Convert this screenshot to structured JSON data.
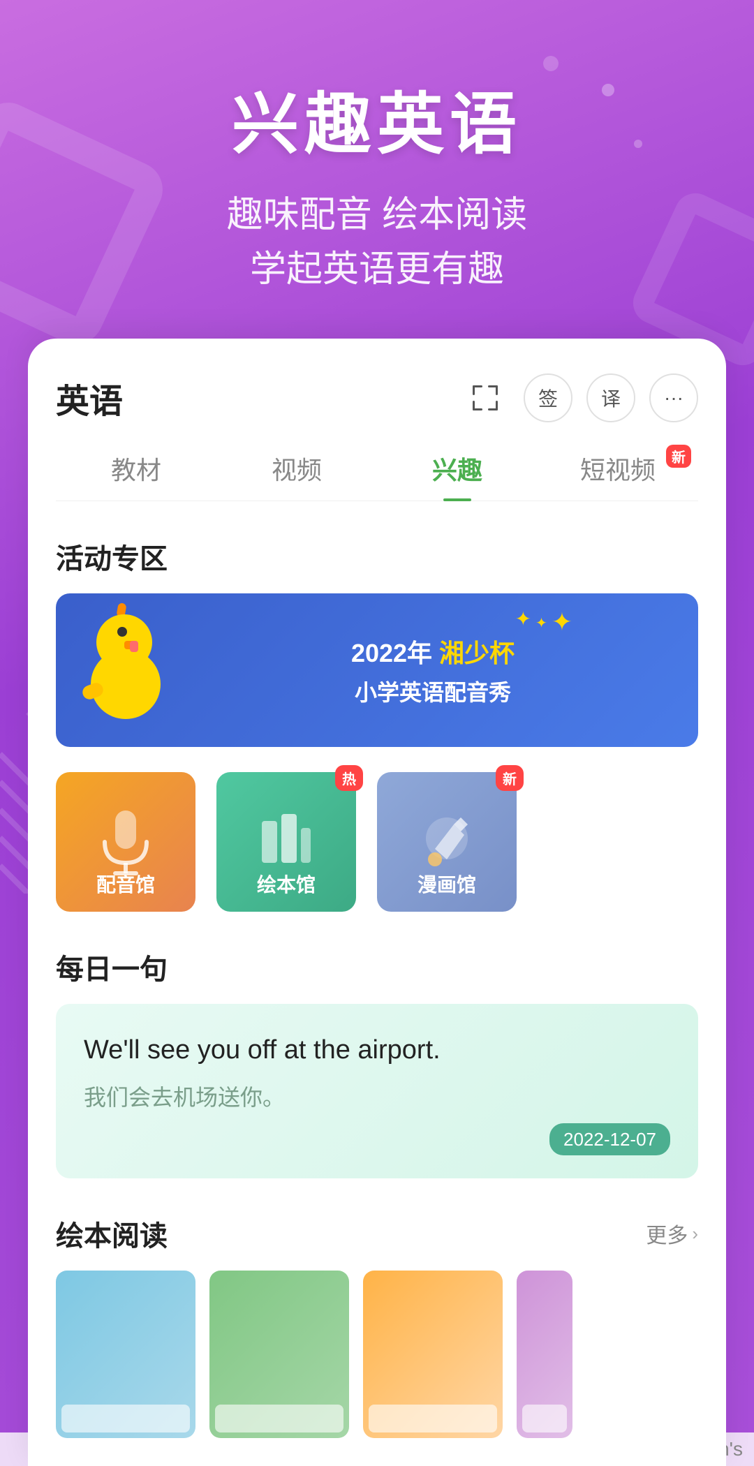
{
  "app": {
    "bg_color": "#9b3fd4"
  },
  "header": {
    "main_title": "兴趣英语",
    "sub_title_line1": "趣味配音 绘本阅读",
    "sub_title_line2": "学起英语更有趣"
  },
  "card": {
    "title": "英语",
    "icons": {
      "scan_label": "扫描",
      "sign_label": "签",
      "translate_label": "译",
      "more_label": "更多"
    },
    "tabs": [
      {
        "id": "textbook",
        "label": "教材",
        "active": false,
        "badge": null
      },
      {
        "id": "video",
        "label": "视频",
        "active": false,
        "badge": null
      },
      {
        "id": "interest",
        "label": "兴趣",
        "active": true,
        "badge": null
      },
      {
        "id": "short-video",
        "label": "短视频",
        "active": false,
        "badge": "新"
      }
    ],
    "activity_section": {
      "title": "活动专区",
      "banner": {
        "year": "2022年",
        "highlight": "湘少杯",
        "subtitle": "小学英语配音秀"
      },
      "features": [
        {
          "id": "dubbing",
          "label": "配音馆",
          "badge": null,
          "color": "orange"
        },
        {
          "id": "picture-book",
          "label": "绘本馆",
          "badge": "热",
          "color": "green"
        },
        {
          "id": "manga",
          "label": "漫画馆",
          "badge": "新",
          "color": "blue"
        }
      ]
    },
    "daily_section": {
      "title": "每日一句",
      "english": "We'll see you off at the airport.",
      "chinese": "我们会去机场送你。",
      "date": "2022-12-07"
    },
    "picture_book_section": {
      "title": "绘本阅读",
      "more_label": "更多",
      "books": []
    }
  },
  "watermark": {
    "text": "Orson's"
  }
}
